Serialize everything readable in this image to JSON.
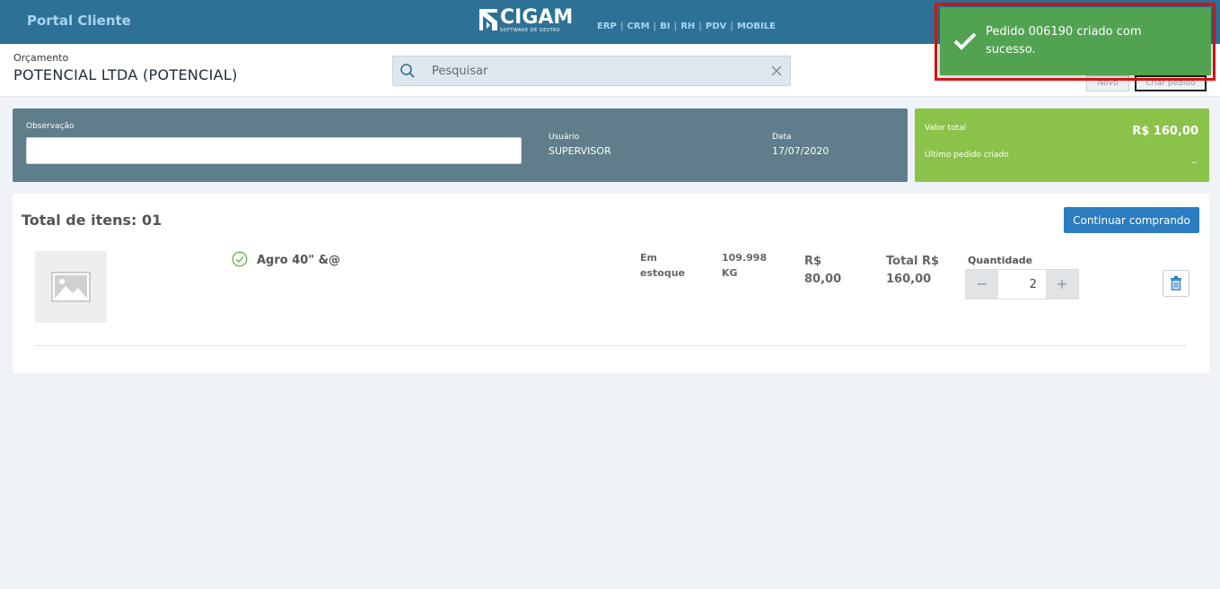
{
  "topbar": {
    "portal_title": "Portal Cliente",
    "logo_text": "CIGAM",
    "logo_sub": "SOFTWARE DE GESTÃO",
    "modules": [
      "ERP",
      "CRM",
      "BI",
      "RH",
      "PDV",
      "MOBILE"
    ],
    "bg_color": "#2d7197"
  },
  "header": {
    "breadcrumb": "Orçamento",
    "company": "POTENCIAL LTDA (POTENCIAL)",
    "search_placeholder": "Pesquisar",
    "btn_novo": "Novo",
    "btn_criar": "Criar pedido"
  },
  "summary": {
    "obs_label": "Observação",
    "obs_value": "",
    "user_label": "Usuário",
    "user_value": "SUPERVISOR",
    "date_label": "Data",
    "date_value": "17/07/2020",
    "total_label": "Valor total",
    "total_value": "R$ 160,00",
    "last_order_label": "Último pedido criado",
    "last_order_value": "_"
  },
  "items": {
    "total_label": "Total de itens: 01",
    "continue_btn": "Continuar comprando",
    "list": [
      {
        "name": "Agro 40\" &@",
        "stock_line1": "Em",
        "stock_line2": "estoque",
        "qty_line1": "109.998",
        "qty_line2": "KG",
        "price_line1": "R$",
        "price_line2": "80,00",
        "total_line1": "Total R$",
        "total_line2": "160,00",
        "qty_label": "Quantidade",
        "quantity": "2"
      }
    ]
  },
  "toast": {
    "message": "Pedido 006190 criado com sucesso.",
    "color": "#51a351"
  }
}
